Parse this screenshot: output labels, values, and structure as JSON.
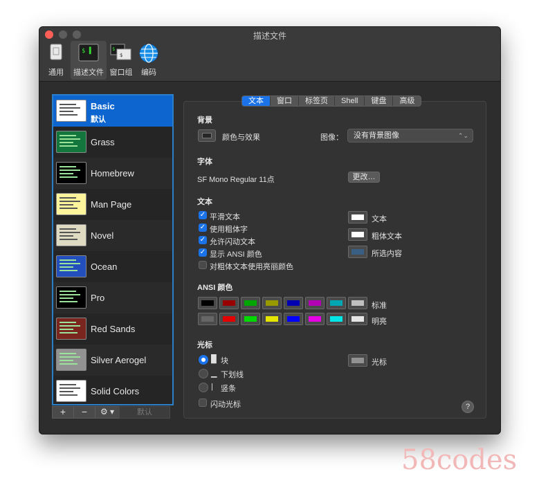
{
  "window": {
    "title": "描述文件"
  },
  "toolbar": {
    "items": [
      {
        "label": "通用",
        "icon": "general-icon"
      },
      {
        "label": "描述文件",
        "icon": "profiles-icon"
      },
      {
        "label": "窗口组",
        "icon": "window-groups-icon"
      },
      {
        "label": "编码",
        "icon": "globe-icon"
      }
    ]
  },
  "sidebar": {
    "profiles": [
      {
        "name": "Basic",
        "sub": "默认",
        "bg": "#ffffff"
      },
      {
        "name": "Grass",
        "bg": "#13773d"
      },
      {
        "name": "Homebrew",
        "bg": "#000000"
      },
      {
        "name": "Man Page",
        "bg": "#fef49c"
      },
      {
        "name": "Novel",
        "bg": "#dfdbc3"
      },
      {
        "name": "Ocean",
        "bg": "#224fbc"
      },
      {
        "name": "Pro",
        "bg": "#000000"
      },
      {
        "name": "Red Sands",
        "bg": "#7a251e"
      },
      {
        "name": "Silver Aerogel",
        "bg": "#929292"
      },
      {
        "name": "Solid Colors",
        "bg": "#ffffff"
      }
    ],
    "add": "+",
    "remove": "−",
    "gear": "⚙",
    "default_button": "默认"
  },
  "tabs": [
    "文本",
    "窗口",
    "标签页",
    "Shell",
    "键盘",
    "高级"
  ],
  "background": {
    "heading": "背景",
    "color_effects": "颜色与效果",
    "image_label": "图像：",
    "image_value": "没有背景图像"
  },
  "font": {
    "heading": "字体",
    "value": "SF Mono Regular 11点",
    "change": "更改…"
  },
  "text": {
    "heading": "文本",
    "options": [
      {
        "label": "平滑文本",
        "checked": true
      },
      {
        "label": "使用粗体字",
        "checked": true
      },
      {
        "label": "允许闪动文本",
        "checked": true
      },
      {
        "label": "显示 ANSI 颜色",
        "checked": true
      },
      {
        "label": "对粗体文本使用亮丽颜色",
        "checked": false
      }
    ],
    "swatches": [
      {
        "label": "文本",
        "color": "#ffffff"
      },
      {
        "label": "粗体文本",
        "color": "#ffffff"
      },
      {
        "label": "所选内容",
        "color": "#3a5f84"
      }
    ]
  },
  "ansi": {
    "heading": "ANSI 颜色",
    "normal_label": "标准",
    "bright_label": "明亮",
    "normal": [
      "#000000",
      "#990000",
      "#00a600",
      "#999900",
      "#0000b2",
      "#b200b2",
      "#00a6b2",
      "#bfbfbf"
    ],
    "bright": [
      "#666666",
      "#e50000",
      "#00d900",
      "#e5e500",
      "#0000ff",
      "#e500e5",
      "#00e5e5",
      "#e5e5e5"
    ]
  },
  "cursor": {
    "heading": "光标",
    "options": [
      {
        "symbol": "█",
        "label": "块",
        "selected": true
      },
      {
        "symbol": "▁",
        "label": "下划线",
        "selected": false
      },
      {
        "symbol": "|",
        "label": "竖条",
        "selected": false
      }
    ],
    "blink_label": "闪动光标",
    "color_label": "光标",
    "color": "#929292"
  },
  "help": "?",
  "watermark": "58codes"
}
